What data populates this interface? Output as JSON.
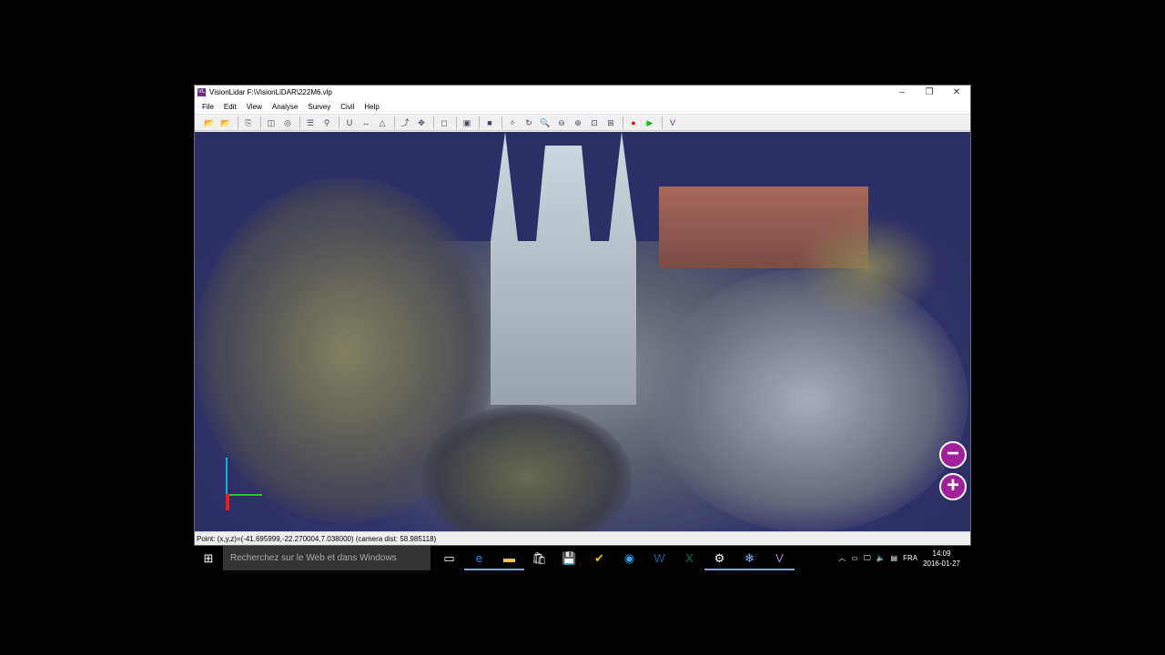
{
  "window": {
    "title": "VisionLidar F:\\VisionLiDAR\\222M6.vlp",
    "icon": "VL"
  },
  "menu": [
    "File",
    "Edit",
    "View",
    "Analyse",
    "Survey",
    "Civil",
    "Help"
  ],
  "toolbar": [
    {
      "name": "open-icon",
      "g": "📂"
    },
    {
      "name": "open-green-icon",
      "g": "📂"
    },
    "sep",
    {
      "name": "import-icon",
      "g": "⎘"
    },
    "sep",
    {
      "name": "copy-icon",
      "g": "◫"
    },
    {
      "name": "layers-icon",
      "g": "◎"
    },
    "sep",
    {
      "name": "list-icon",
      "g": "☰"
    },
    {
      "name": "pin-icon",
      "g": "⚲"
    },
    "sep",
    {
      "name": "magnet-icon",
      "g": "U"
    },
    {
      "name": "measure-icon",
      "g": "↔"
    },
    {
      "name": "angle-icon",
      "g": "△"
    },
    "sep",
    {
      "name": "axis-icon",
      "g": "⤴"
    },
    {
      "name": "move-icon",
      "g": "✥"
    },
    "sep",
    {
      "name": "wire-cube-icon",
      "g": "◻"
    },
    "sep",
    {
      "name": "box-icon",
      "g": "▣"
    },
    "sep",
    {
      "name": "solid-cube-icon",
      "g": "■"
    },
    "sep",
    {
      "name": "pan-icon",
      "g": "✧"
    },
    {
      "name": "rotate-icon",
      "g": "↻"
    },
    {
      "name": "zoom-icon",
      "g": "🔍"
    },
    {
      "name": "zoom-out-icon",
      "g": "⊖"
    },
    {
      "name": "zoom-all-icon",
      "g": "⊕"
    },
    {
      "name": "zoom-window-icon",
      "g": "⊡"
    },
    {
      "name": "zoom-select-icon",
      "g": "⊞"
    },
    "sep",
    {
      "name": "record-icon",
      "g": "●",
      "c": "#e00"
    },
    {
      "name": "play-icon",
      "g": "▶",
      "c": "#1b1"
    },
    "sep",
    {
      "name": "vl-logo-icon",
      "g": "V",
      "c": "#6b2a8a"
    }
  ],
  "status": "Point:  (x,y,z)=(-41.695999,-22.270004,7.038000)  (camera dist: 58.985118)",
  "zoom": {
    "minus": "−",
    "plus": "+"
  },
  "taskbar": {
    "search_placeholder": "Recherchez sur le Web et dans Windows",
    "apps": [
      {
        "name": "task-view",
        "g": "▭"
      },
      {
        "name": "edge",
        "g": "e",
        "c": "#1e90ff",
        "act": true
      },
      {
        "name": "explorer",
        "g": "▬",
        "c": "#f2c94c",
        "act": true
      },
      {
        "name": "store",
        "g": "🛍"
      },
      {
        "name": "save",
        "g": "💾"
      },
      {
        "name": "norton",
        "g": "✔",
        "c": "#f0c000"
      },
      {
        "name": "browser",
        "g": "◉",
        "c": "#3aa0f0"
      },
      {
        "name": "word",
        "g": "W",
        "c": "#2b579a"
      },
      {
        "name": "excel",
        "g": "X",
        "c": "#217346"
      },
      {
        "name": "settings",
        "g": "⚙",
        "act": true
      },
      {
        "name": "snowflake",
        "g": "❄",
        "c": "#7fb8ff",
        "act": true
      },
      {
        "name": "visionlidar",
        "g": "V",
        "c": "#b37fd0",
        "act": true
      }
    ],
    "lang": "FRA",
    "time": "14:09",
    "date": "2016-01-27"
  }
}
